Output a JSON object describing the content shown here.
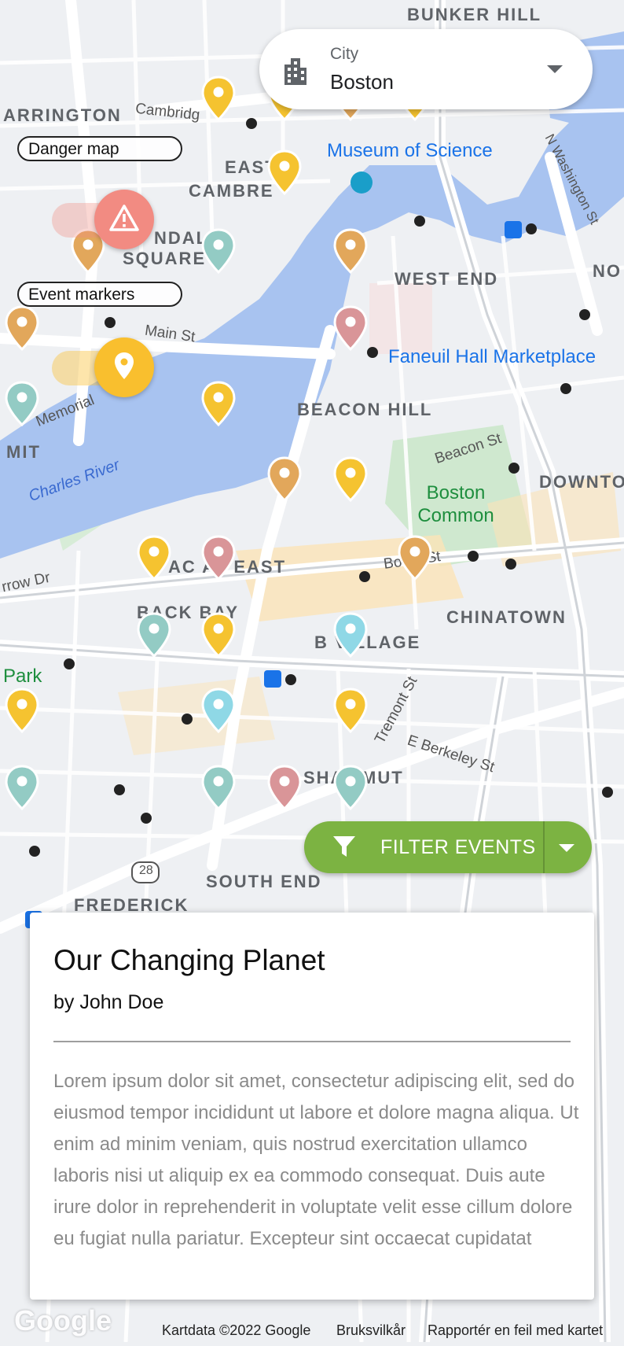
{
  "city_selector": {
    "caption": "City",
    "value": "Boston"
  },
  "layers": {
    "danger_label": "Danger map",
    "events_label": "Event markers"
  },
  "filter": {
    "label": "FILTER EVENTS"
  },
  "card": {
    "title": "Our Changing Planet",
    "author": "by John Doe",
    "body": "Lorem ipsum dolor sit amet, consectetur adipiscing elit, sed do eiusmod tempor incididunt ut labore et dolore magna aliqua. Ut enim ad minim veniam, quis nostrud exercitation ullamco laboris nisi ut aliquip ex ea commodo consequat. Duis aute irure dolor in reprehenderit in voluptate velit esse cillum dolore eu fugiat nulla pariatur. Excepteur sint occaecat cupidatat"
  },
  "map": {
    "labels": {
      "bunker_hill": "BUNKER HILL",
      "arrington": "ARRINGTON",
      "cambridge_st": "Cambridg",
      "museum": "Museum of Science",
      "east": "EAST",
      "cambre": "CAMBRE",
      "ndall": "NDALL",
      "square": "SQUARE",
      "west_end": "WEST END",
      "no": "NO",
      "main_st": "Main St",
      "faneuil": "Faneuil Hall Marketplace",
      "beacon_hill": "BEACON HILL",
      "memorial": "Memorial",
      "mit": "MIT",
      "charles_river": "Charles River",
      "beacon_st": "Beacon St",
      "downtown": "DOWNTO",
      "boston_common": "Boston Common",
      "arrow_dr": "rrow Dr",
      "back_bay_east": "AC    AY EAST",
      "boylston_st": "Bo     on St",
      "back_bay": "BACK BAY",
      "chinatown": "CHINATOWN",
      "village": "B    VILLAGE",
      "park": "Park",
      "tremont_st": "Tremont St",
      "e_berkeley_st": "E Berkeley St",
      "shawmut": "SHAWMUT",
      "south_end": "SOUTH END",
      "frederick": "FREDERICK",
      "route_28": "28",
      "washington_st": "N Washington St"
    },
    "markers": [
      {
        "color": "#f5c330"
      },
      {
        "color": "#f5c330"
      },
      {
        "color": "#e2a75b"
      },
      {
        "color": "#f5c330"
      },
      {
        "color": "#f5c330"
      },
      {
        "color": "#e2a75b"
      },
      {
        "color": "#93cbc4"
      },
      {
        "color": "#e2a75b"
      },
      {
        "color": "#e2a75b"
      },
      {
        "color": "#d99598"
      },
      {
        "color": "#93cbc4"
      },
      {
        "color": "#f5c330"
      },
      {
        "color": "#e2a75b"
      },
      {
        "color": "#f5c330"
      },
      {
        "color": "#f5c330"
      },
      {
        "color": "#d99598"
      },
      {
        "color": "#e2a75b"
      },
      {
        "color": "#93cbc4"
      },
      {
        "color": "#f5c330"
      },
      {
        "color": "#8fd8e6"
      },
      {
        "color": "#f5c330"
      },
      {
        "color": "#8fd8e6"
      },
      {
        "color": "#f5c330"
      },
      {
        "color": "#93cbc4"
      },
      {
        "color": "#93cbc4"
      },
      {
        "color": "#d99598"
      },
      {
        "color": "#93cbc4"
      }
    ]
  },
  "attribution": {
    "logo": "Google",
    "map_data": "Kartdata ©2022 Google",
    "terms": "Bruksvilkår",
    "report": "Rapportér en feil med kartet"
  },
  "colors": {
    "water": "#a8c3f0",
    "park": "#c8e6c9",
    "filter_green": "#7cb342",
    "danger_red": "#f28b82",
    "event_yellow": "#f9bf2e"
  }
}
